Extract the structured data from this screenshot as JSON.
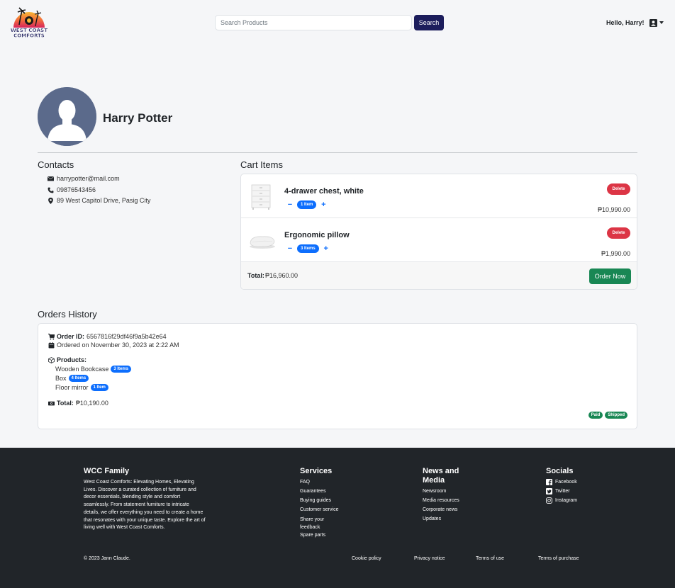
{
  "brand": {
    "logo_alt": "West Coast Comforts",
    "logo_line1": "WEST COAST",
    "logo_line2": "COMFORTS"
  },
  "header": {
    "search_placeholder": "Search Products",
    "search_value": "",
    "search_label": "Search",
    "greeting": "Hello, Harry!"
  },
  "profile": {
    "name": "Harry Potter"
  },
  "contacts": {
    "title": "Contacts",
    "email": "harrypotter@mail.com",
    "phone": "09876543456",
    "address": "89 West Capitol Drive, Pasig City"
  },
  "cart": {
    "title": "Cart Items",
    "items": [
      {
        "name": "4-drawer chest, white",
        "qty_label": "1 Item",
        "price": "₱10,990.00",
        "delete_label": "Delete",
        "decrease": "−",
        "increase": "+"
      },
      {
        "name": "Ergonomic pillow",
        "qty_label": "3 Items",
        "price": "₱1,990.00",
        "delete_label": "Delete",
        "decrease": "−",
        "increase": "+"
      }
    ],
    "total_label": "Total:",
    "total_value": "₱16,960.00",
    "order_label": "Order Now"
  },
  "orders": {
    "title": "Orders History",
    "list": [
      {
        "id_label": "Order ID:",
        "id_value": "6567816f29df46f9a5b42e64",
        "date": "Ordered on November 30, 2023 at 2:22 AM",
        "products_label": "Products:",
        "products": [
          {
            "name": "Wooden Bookcase",
            "qty": "3 Items"
          },
          {
            "name": "Box",
            "qty": "4 Items"
          },
          {
            "name": "Floor mirror",
            "qty": "1 Item"
          }
        ],
        "total_label": "Total:",
        "total_value": "₱10,190.00",
        "statuses": [
          "Paid",
          "Shipped"
        ]
      }
    ]
  },
  "footer": {
    "family_title": "WCC Family",
    "family_desc": "West Coast Comforts: Elevating Homes, Elevating Lives. Discover a curated collection of furniture and decor essentials, blending style and comfort seamlessly. From statement furniture to intricate details, we offer everything you need to create a home that resonates with your unique taste. Explore the art of living well with West Coast Comforts.",
    "services_title": "Services",
    "services": [
      "FAQ",
      "Guarantees",
      "Buying guides",
      "Customer service",
      "Share your feedback",
      "Spare parts"
    ],
    "news_title": "News and Media",
    "news": [
      "Newsroom",
      "Media resources",
      "Corporate news",
      "Updates"
    ],
    "socials_title": "Socials",
    "socials": [
      "Facebook",
      "Twitter",
      "Instagram"
    ],
    "copyright": "© 2023 Jann Claude.",
    "legal": [
      "Cookie policy",
      "Privacy notice",
      "Terms of use",
      "Terms of purchase"
    ]
  },
  "colors": {
    "navy": "#1c1d5c",
    "blue": "#0d6efd",
    "green": "#198754",
    "red": "#dc3545",
    "footer_bg": "#212529"
  }
}
